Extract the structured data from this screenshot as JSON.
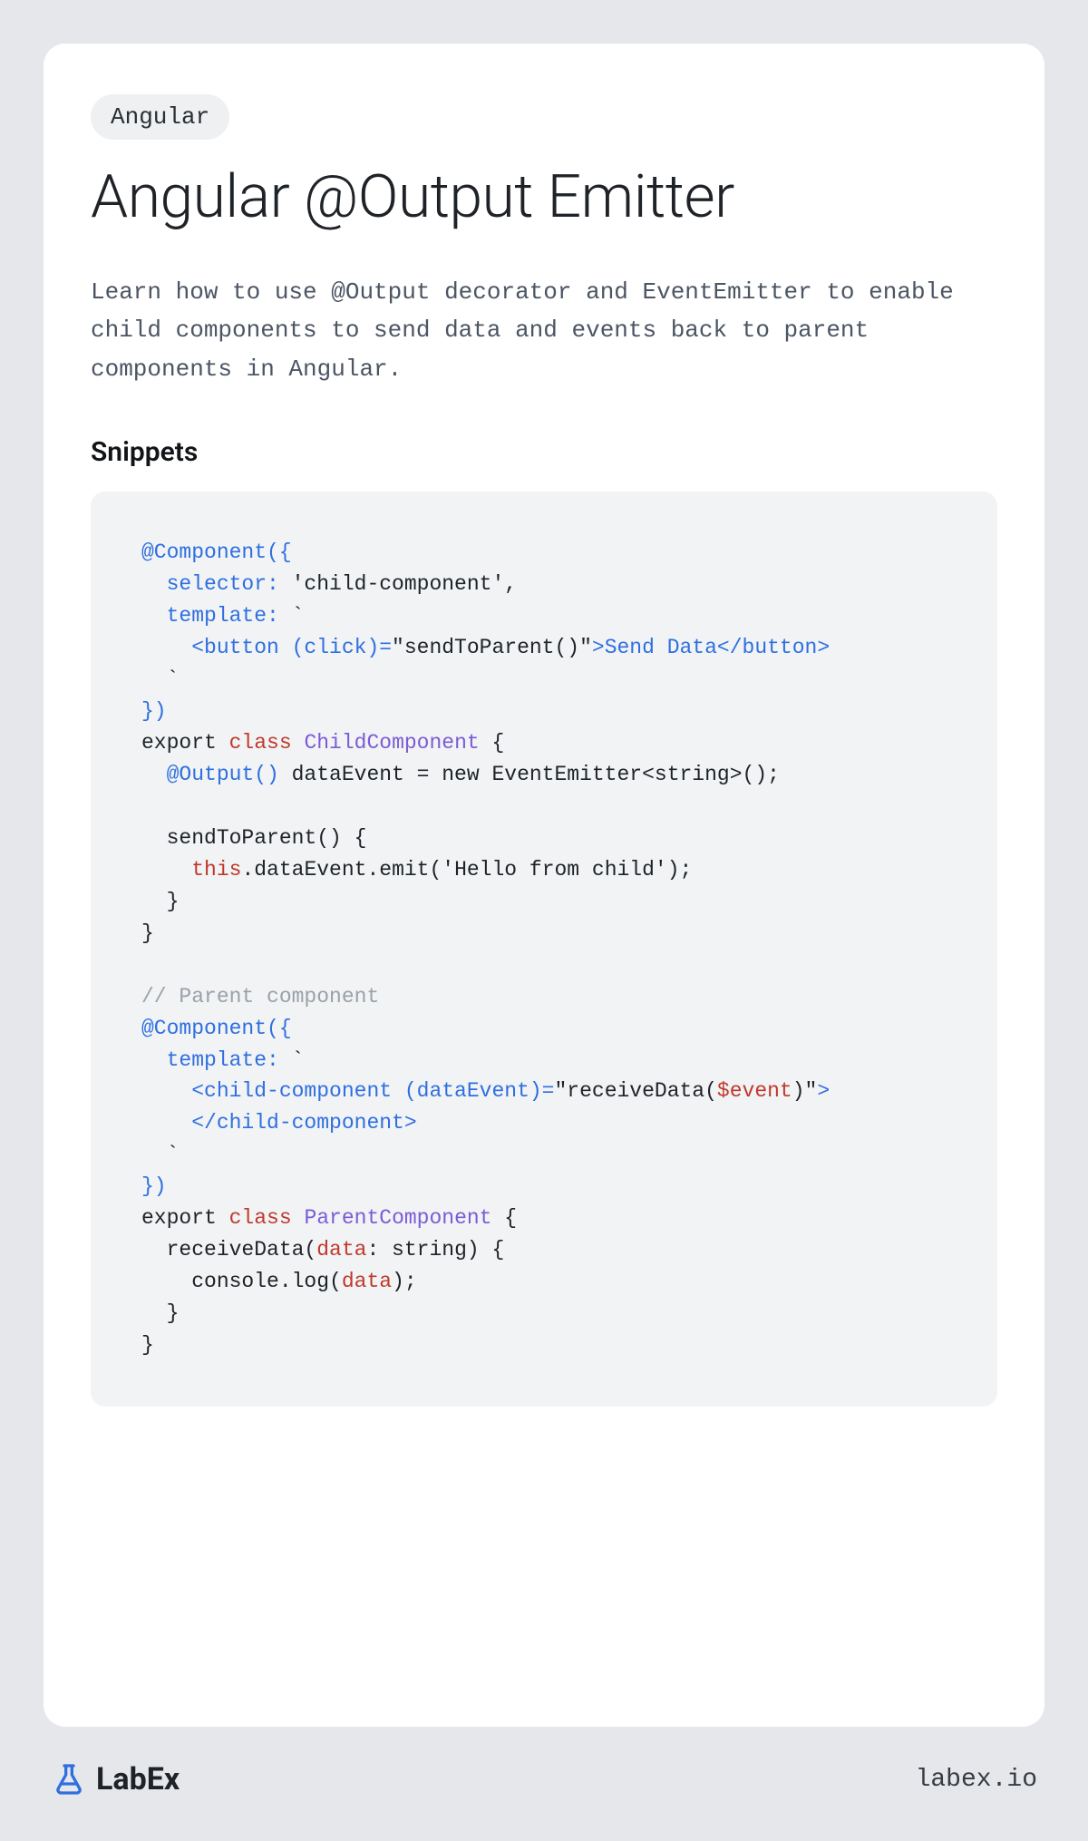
{
  "tag": "Angular",
  "title": "Angular @Output Emitter",
  "description": "Learn how to use @Output decorator and EventEmitter to enable child components to send data and events back to parent components in Angular.",
  "section_heading": "Snippets",
  "code": {
    "l1_a": "@Component",
    "l1_b": "({",
    "l2_a": "  selector:",
    "l2_b": " 'child-component'",
    "l2_c": ",",
    "l3_a": "  template:",
    "l3_b": " `",
    "l4_a": "    <button (click)=",
    "l4_b": "\"sendToParent()\"",
    "l4_c": ">Send Data</button>",
    "l5_a": "  `",
    "l6_a": "})",
    "l7_a": "export ",
    "l7_b": "class",
    "l7_c": " ",
    "l7_d": "ChildComponent",
    "l7_e": " {",
    "l8_a": "  @Output()",
    "l8_b": " dataEvent = new EventEmitter<string>();",
    "l9_blank": "",
    "l10_a": "  sendToParent() {",
    "l11_a": "    ",
    "l11_b": "this",
    "l11_c": ".dataEvent.emit('Hello from child');",
    "l12_a": "  }",
    "l13_a": "}",
    "l14_blank": "",
    "l15_a": "// Parent component",
    "l16_a": "@Component",
    "l16_b": "({",
    "l17_a": "  template:",
    "l17_b": " `",
    "l18_a": "    <child-component (dataEvent)=",
    "l18_b": "\"receiveData(",
    "l18_c": "$event",
    "l18_d": ")\"",
    "l18_e": ">",
    "l19_a": "    </child-component>",
    "l20_a": "  `",
    "l21_a": "})",
    "l22_a": "export ",
    "l22_b": "class",
    "l22_c": " ",
    "l22_d": "ParentComponent",
    "l22_e": " {",
    "l23_a": "  receiveData(",
    "l23_b": "data",
    "l23_c": ": string) {",
    "l24_a": "    console.log(",
    "l24_b": "data",
    "l24_c": ");",
    "l25_a": "  }",
    "l26_a": "}"
  },
  "brand": {
    "name": "LabEx",
    "url": "labex.io",
    "accent": "#2f6fe0"
  }
}
